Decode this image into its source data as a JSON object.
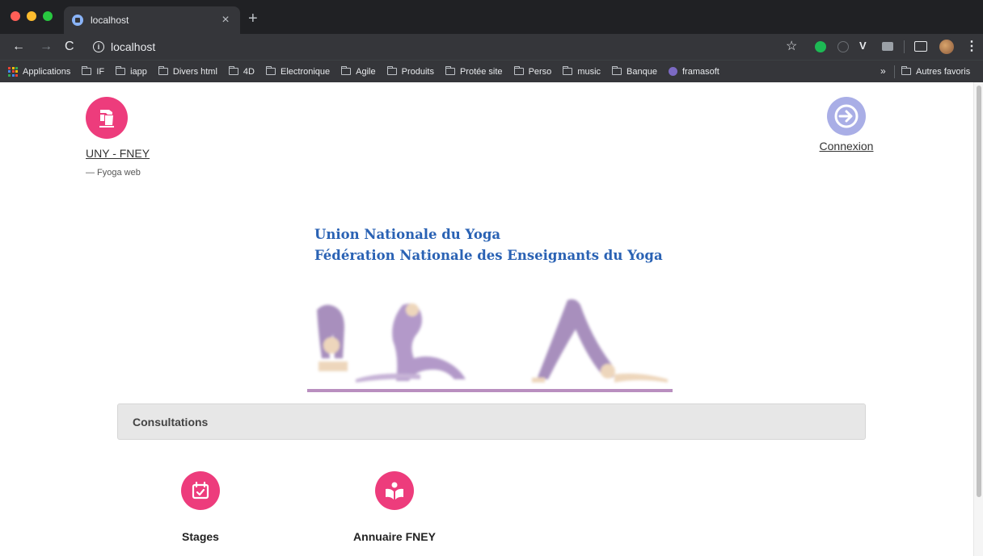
{
  "browser": {
    "tab_title": "localhost",
    "tab_close": "×",
    "new_tab": "+",
    "url": "localhost",
    "bookmarks": [
      {
        "label": "Applications",
        "icon": "apps-grid-icon"
      },
      {
        "label": "IF",
        "icon": "folder-icon"
      },
      {
        "label": "iapp",
        "icon": "folder-icon"
      },
      {
        "label": "Divers html",
        "icon": "folder-icon"
      },
      {
        "label": "4D",
        "icon": "folder-icon"
      },
      {
        "label": "Electronique",
        "icon": "folder-icon"
      },
      {
        "label": "Agile",
        "icon": "folder-icon"
      },
      {
        "label": "Produits",
        "icon": "folder-icon"
      },
      {
        "label": "Protée site",
        "icon": "folder-icon"
      },
      {
        "label": "Perso",
        "icon": "folder-icon"
      },
      {
        "label": "music",
        "icon": "folder-icon"
      },
      {
        "label": "Banque",
        "icon": "folder-icon"
      },
      {
        "label": "framasoft",
        "icon": "shield-icon"
      }
    ],
    "bookmarks_more": "»",
    "other_bookmarks": "Autres favoris"
  },
  "header": {
    "brand_name": "UNY - FNEY",
    "brand_tagline": "— Fyoga web",
    "login_label": "Connexion"
  },
  "banner": {
    "line1": "Union Nationale du Yoga",
    "line2": "Fédération Nationale des Enseignants du Yoga"
  },
  "section": {
    "title": "Consultations"
  },
  "tiles": [
    {
      "label": "Stages",
      "icon": "calendar-check-icon"
    },
    {
      "label": "Annuaire FNEY",
      "icon": "open-book-icon"
    }
  ],
  "colors": {
    "brand_pink": "#ed3c7c",
    "login_lavender": "#a9aee6",
    "banner_blue": "#2a62b4",
    "panel_gray": "#e7e7e7"
  }
}
